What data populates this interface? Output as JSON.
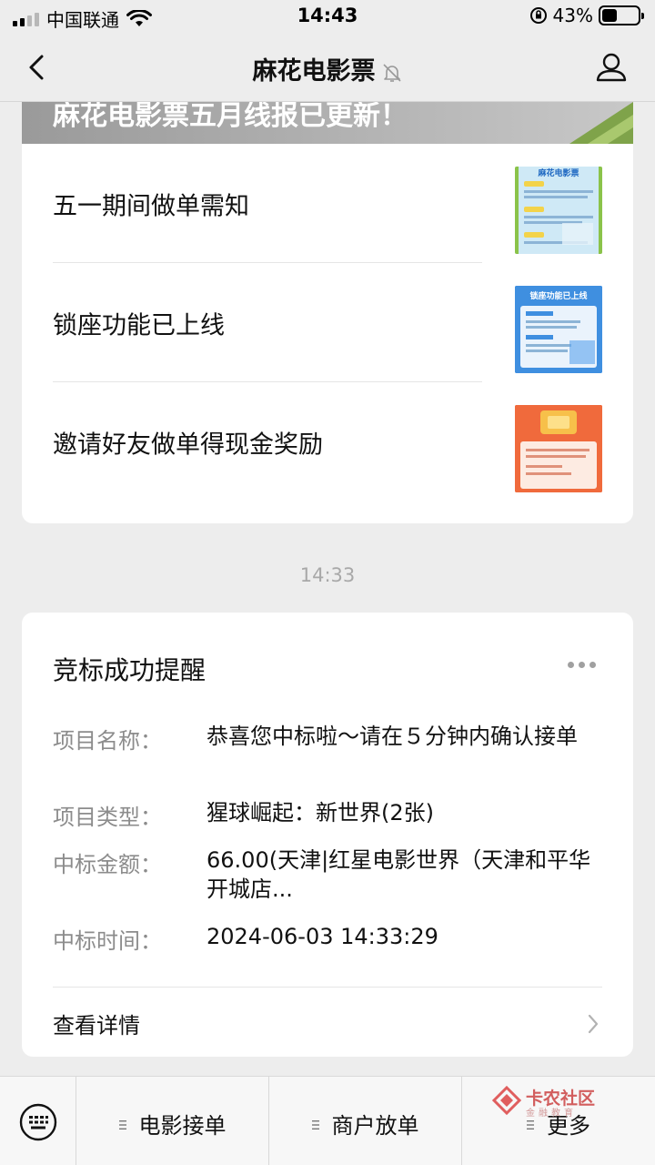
{
  "status_bar": {
    "carrier": "中国联通",
    "time": "14:43",
    "battery_percent": "43%",
    "battery_level": 0.43
  },
  "nav": {
    "title": "麻花电影票"
  },
  "article_card": {
    "banner_text": "麻花电影票五月线报已更新！",
    "items": [
      {
        "title": "五一期间做单需知",
        "thumb_caption": "麻花电影票"
      },
      {
        "title": "锁座功能已上线",
        "thumb_caption": "锁座功能已上线"
      },
      {
        "title": "邀请好友做单得现金奖励",
        "thumb_caption": ""
      }
    ]
  },
  "timestamp": "14:33",
  "notice": {
    "title": "竞标成功提醒",
    "fields": [
      {
        "label": "项目名称：",
        "value": "恭喜您中标啦～请在５分钟内确认接单"
      },
      {
        "label": "项目类型：",
        "value": "猩球崛起：新世界(2张)"
      },
      {
        "label": "中标金额：",
        "value": "66.00(天津|红星电影世界（天津和平华开城店..."
      },
      {
        "label": "中标时间：",
        "value": "2024-06-03 14:33:29"
      }
    ],
    "detail_label": "查看详情"
  },
  "bottom_menu": {
    "tabs": [
      "电影接单",
      "商户放单",
      "更多"
    ]
  },
  "watermark": {
    "text": "卡农社区",
    "sub": "金融教育"
  },
  "colors": {
    "background": "#ededed",
    "card": "#ffffff",
    "muted_text": "#8c8c8c"
  }
}
